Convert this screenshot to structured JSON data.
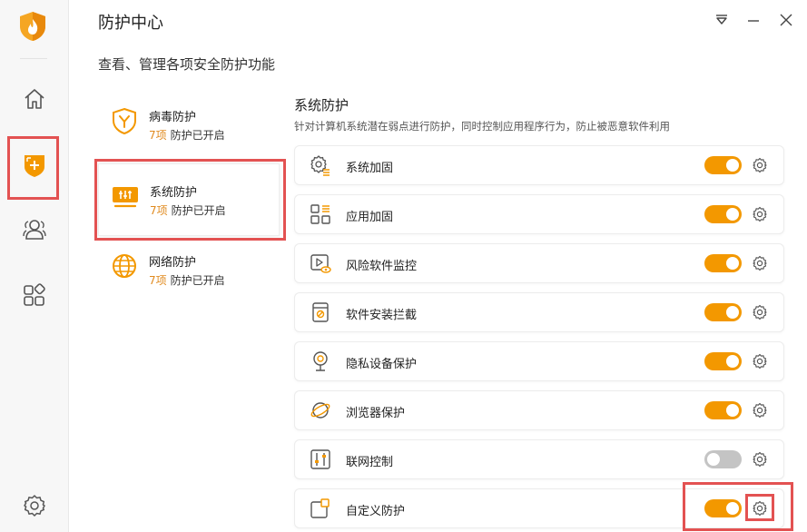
{
  "window": {
    "title": "防护中心",
    "subtitle": "查看、管理各项安全防护功能"
  },
  "rail": {
    "items": [
      {
        "name": "home",
        "icon": "home-icon"
      },
      {
        "name": "protection",
        "icon": "shield-plus-icon",
        "active": true
      },
      {
        "name": "users",
        "icon": "users-icon"
      },
      {
        "name": "apps",
        "icon": "apps-grid-icon"
      },
      {
        "name": "settings",
        "icon": "gear-icon"
      }
    ]
  },
  "categories": [
    {
      "name": "病毒防护",
      "count": "7项",
      "status": "防护已开启",
      "icon": "virus-shield-icon"
    },
    {
      "name": "系统防护",
      "count": "7项",
      "status": "防护已开启",
      "icon": "system-monitor-icon",
      "selected": true
    },
    {
      "name": "网络防护",
      "count": "7项",
      "status": "防护已开启",
      "icon": "globe-icon"
    }
  ],
  "section": {
    "title": "系统防护",
    "description": "针对计算机系统潜在弱点进行防护，同时控制应用程序行为，防止被恶意软件利用"
  },
  "features": [
    {
      "label": "系统加固",
      "enabled": true,
      "icon": "gear-list-icon"
    },
    {
      "label": "应用加固",
      "enabled": true,
      "icon": "grid-list-icon"
    },
    {
      "label": "风险软件监控",
      "enabled": true,
      "icon": "play-eye-icon"
    },
    {
      "label": "软件安装拦截",
      "enabled": true,
      "icon": "package-block-icon"
    },
    {
      "label": "隐私设备保护",
      "enabled": true,
      "icon": "webcam-icon"
    },
    {
      "label": "浏览器保护",
      "enabled": true,
      "icon": "browser-planet-icon"
    },
    {
      "label": "联网控制",
      "enabled": false,
      "icon": "sliders-icon"
    },
    {
      "label": "自定义防护",
      "enabled": true,
      "icon": "custom-window-icon"
    }
  ],
  "colors": {
    "accent": "#f39800",
    "highlight_frame": "#e35252",
    "toggle_off": "#c4c4c4",
    "count_text": "#e08a1e"
  }
}
